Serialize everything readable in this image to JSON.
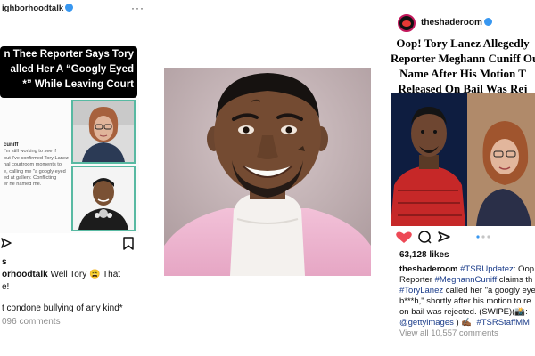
{
  "left_post": {
    "username": "ighborhoodtalk",
    "banner_lines": [
      "n Thee Reporter Says Tory",
      "alled Her A “Googly Eyed",
      "*” While Leaving Court"
    ],
    "tweet_author": "cuniff",
    "tweet_lines": [
      "I'm still working to see if",
      "out I've confirmed Tory Lanez",
      "nal courtroom moments to",
      "e, calling me \"a googly eyed",
      "ed at gallery. Conflicting",
      "er he named me."
    ],
    "likes": "s",
    "caption_user": "orhoodtalk",
    "caption_text": " Well Tory 😩 That",
    "caption_line2": "e!",
    "caption_line3": "t condone bullying of any kind*",
    "comments": "096 comments"
  },
  "right_post": {
    "username": "theshaderoom",
    "headline_lines": [
      "Oop! Tory Lanez Allegedly",
      "Reporter Meghann Cuniff Ou",
      "Name After His Motion T",
      "Released On Bail Was Rej"
    ],
    "likes": "63,128 likes",
    "caption_lines": [
      {
        "user": "theshaderoom",
        "tag": " #TSRUpdatez",
        "text": ": Oop"
      },
      {
        "text": "Reporter ",
        "tag": "#MeghannCuniff",
        "text2": " claims th"
      },
      {
        "tag": "#ToryLanez",
        "text": " called her \"a googly eye"
      },
      {
        "text": "b***h,\" shortly after his motion to re"
      },
      {
        "text": "on bail was rejected. (SWIPE)(📸:"
      },
      {
        "tag": "@gettyimages",
        "text": " ) ✍🏾: ",
        "tag2": "#TSRStaffMM"
      }
    ],
    "comments": "View all 10,557 comments"
  },
  "colors": {
    "verified": "#3897f0",
    "accent_border": "#58b9a2",
    "like_red": "#ed4956",
    "hashtag": "#1a3c8a"
  }
}
